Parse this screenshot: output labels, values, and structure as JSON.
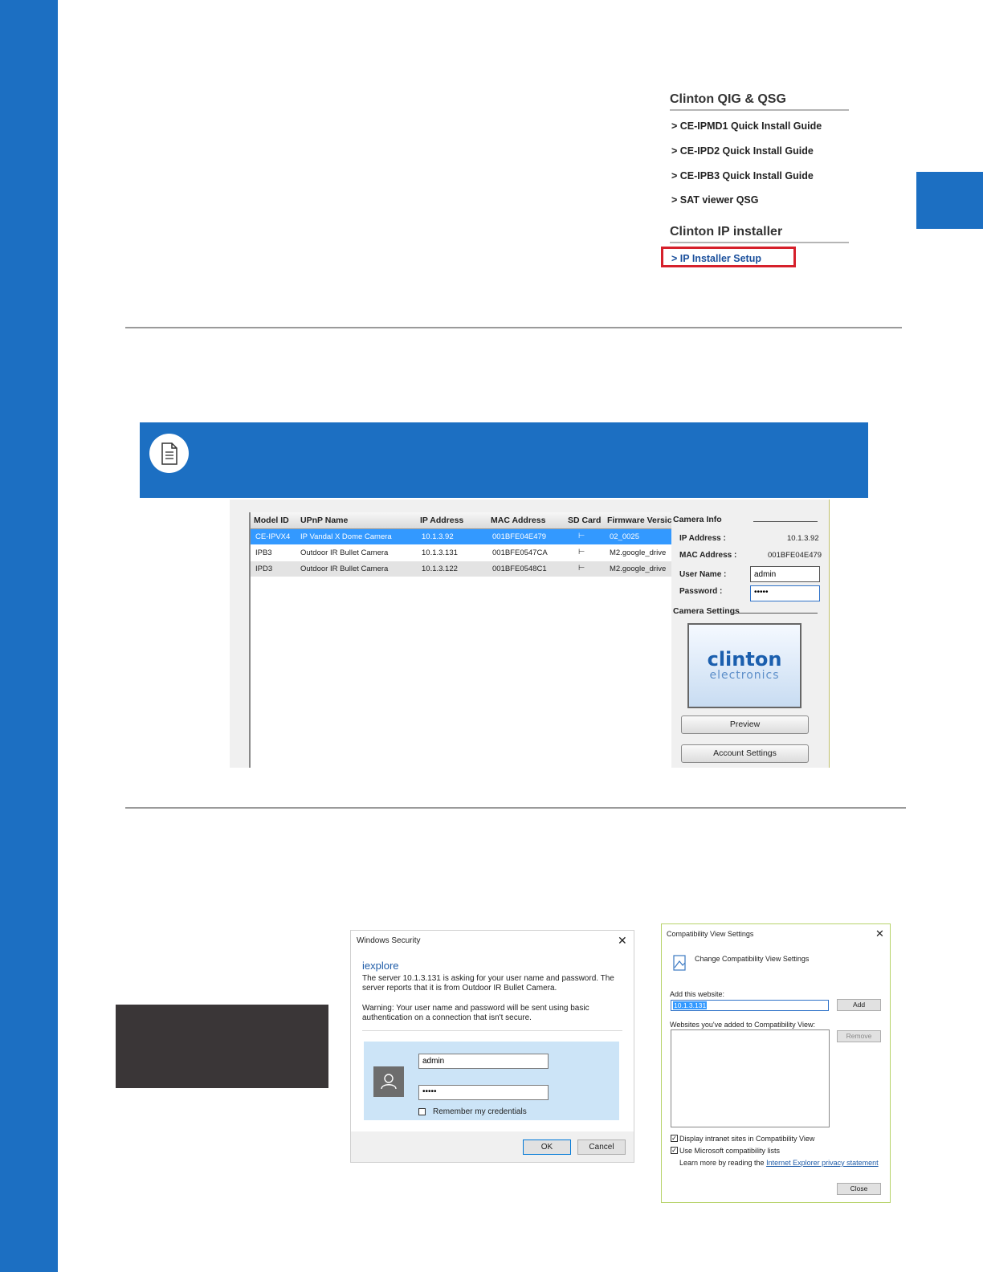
{
  "colors": {
    "brand_blue": "#1c6fc2",
    "highlight_red": "#d6202b",
    "selection_blue": "#3399ff",
    "dark_box": "#3a3637"
  },
  "docs_panel": {
    "qig_heading": "Clinton QIG & QSG",
    "qig_links": [
      "> CE-IPMD1 Quick Install Guide",
      "> CE-IPD2 Quick Install Guide",
      "> CE-IPB3 Quick Install Guide",
      "> SAT viewer QSG"
    ],
    "installer_heading": "Clinton IP installer",
    "installer_link": "> IP Installer Setup"
  },
  "note_icon": "document-icon",
  "installer": {
    "columns": [
      "Model ID",
      "UPnP Name",
      "IP Address",
      "MAC Address",
      "SD Card",
      "Firmware Versic"
    ],
    "rows": [
      {
        "model": "CE-IPVX4",
        "name": "IP Vandal X Dome Camera",
        "ip": "10.1.3.92",
        "mac": "001BFE04E479",
        "sd": "⊢",
        "fw": "02_0025"
      },
      {
        "model": "IPB3",
        "name": "Outdoor IR Bullet Camera",
        "ip": "10.1.3.131",
        "mac": "001BFE0547CA",
        "sd": "⊢",
        "fw": "M2.google_drive"
      },
      {
        "model": "IPD3",
        "name": "Outdoor IR Bullet Camera",
        "ip": "10.1.3.122",
        "mac": "001BFE0548C1",
        "sd": "⊢",
        "fw": "M2.google_drive"
      }
    ],
    "camera_info": {
      "heading": "Camera Info",
      "ip_label": "IP Address :",
      "ip_value": "10.1.3.92",
      "mac_label": "MAC Address :",
      "mac_value": "001BFE04E479",
      "user_label": "User Name :",
      "user_value": "admin",
      "password_label": "Password :",
      "password_value": "•••••"
    },
    "camera_settings": {
      "heading": "Camera Settings",
      "logo_main": "clinton",
      "logo_sub": "electronics",
      "preview_button": "Preview",
      "account_button": "Account Settings"
    }
  },
  "windows_security": {
    "title": "Windows Security",
    "app": "iexplore",
    "line1": "The server 10.1.3.131 is asking for your user name and password. The",
    "line2": "server reports that it is from Outdoor IR Bullet Camera.",
    "warn1": "Warning: Your user name and password will be sent using basic",
    "warn2": "authentication on a connection that isn't secure.",
    "username": "admin",
    "password": "•••••",
    "remember": "Remember my credentials",
    "ok": "OK",
    "cancel": "Cancel"
  },
  "compat_view": {
    "title": "Compatibility View Settings",
    "subtitle": "Change Compatibility View Settings",
    "add_label": "Add this website:",
    "website_value": "10.1.3.131",
    "add_button": "Add",
    "list_label": "Websites you've added to Compatibility View:",
    "remove_button": "Remove",
    "check1": "Display intranet sites in Compatibility View",
    "check2": "Use Microsoft compatibility lists",
    "learn_prefix": "Learn more by reading the ",
    "learn_link": "Internet Explorer privacy statement",
    "close_button": "Close"
  }
}
